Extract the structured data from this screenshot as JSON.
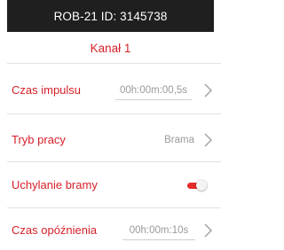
{
  "header": {
    "title": "ROB-21 ID: 3145738"
  },
  "channel": {
    "title": "Kanał 1"
  },
  "settings": {
    "pulse_time": {
      "label": "Czas impulsu",
      "value": "00h:00m:00,5s"
    },
    "work_mode": {
      "label": "Tryb pracy",
      "value": "Brama"
    },
    "gate_opening": {
      "label": "Uchylanie bramy",
      "enabled": true
    },
    "delay_time": {
      "label": "Czas opóźnienia",
      "value": "00h:00m:10s"
    }
  },
  "colors": {
    "accent": "#d61f27",
    "header_bg": "#1f1f1f",
    "value_text": "#9a9a9a"
  }
}
